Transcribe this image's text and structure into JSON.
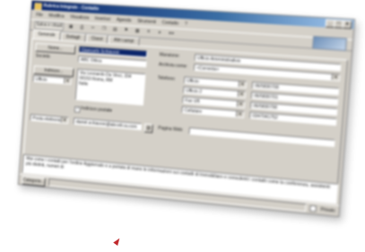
{
  "window": {
    "title": "Rubrica Integrale - Contatto",
    "controls": {
      "minimize": "_",
      "maximize": "□",
      "close": "x"
    }
  },
  "menu": [
    "File",
    "Modifica",
    "Visualizza",
    "Inserisci",
    "Agenda",
    "Strumenti",
    "Contatto",
    "?"
  ],
  "toolbar": {
    "save_close": "Salva e chiudi",
    "icons": [
      "floppy-icon",
      "print-icon",
      "cut-icon",
      "copy-icon",
      "paste-icon",
      "flag-icon",
      "calendar-icon",
      "delete-icon",
      "arrow-icon",
      "navigation-icon"
    ]
  },
  "tabs": [
    "Generale",
    "Dettagli",
    "Classi",
    "Altri campi"
  ],
  "form": {
    "nome_button": "Nome...",
    "nome_value": "Giancarlo Schiavoni",
    "societa_label": "Società:",
    "societa_value": "ABC Ottica",
    "indirizzo_button": "Indirizzo...",
    "indirizzo_type": "Ufficio",
    "indirizzo_value": "Via Leonardo Da Vinci, 154\n00153 Roma, RM\nItalia",
    "postale_label": "Indirizzo postale",
    "postale_checked": "✓",
    "mansione_label": "Mansione:",
    "mansione_value": "Ufficio Amministrativo",
    "archivia_label": "Archivia come:",
    "archivia_value": "<Corrente>",
    "telefono_label": "Telefono:",
    "phones": [
      {
        "type": "Ufficio",
        "number": "06/5830700"
      },
      {
        "type": "Ufficio 2",
        "number": "06/5830701"
      },
      {
        "type": "Fax Uff.",
        "number": "06/5830790"
      },
      {
        "type": "Cellulare",
        "number": "0347041752"
      }
    ],
    "email_type": "Posta elettronica",
    "email_value": "daniel.schiavoni@abcottica.com",
    "web_label": "Pagina Web:",
    "web_value": ""
  },
  "notes": "Mai come i contatti per l'ordine Aggiornato e a portata di mano le informazioni sui contatti di Immobiliare e consulenti i contatti come la conferenza, assistenti più distinti, numeri di",
  "statusbar": {
    "categories_button": "Categorie...",
    "private_label": "Privato"
  },
  "colors": {
    "window_face": "#d4d0c8",
    "title_start": "#0a246a",
    "title_end": "#a6caf0",
    "cursor": "#c0282c"
  }
}
